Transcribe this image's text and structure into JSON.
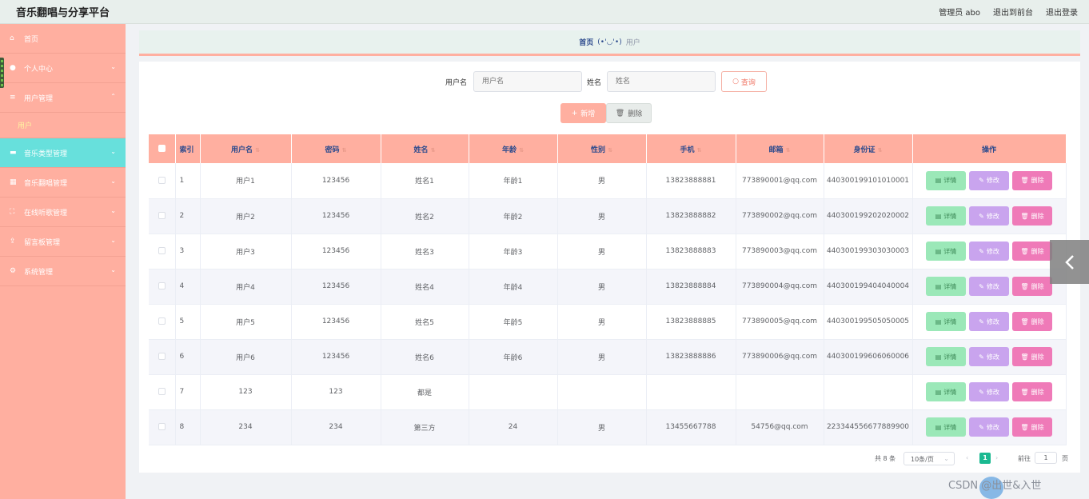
{
  "header": {
    "title": "音乐翻唱与分享平台",
    "admin": "管理员 abo",
    "back_front": "退出到前台",
    "logout": "退出登录"
  },
  "sidebar": {
    "items": [
      {
        "label": "首页",
        "icon": "home-icon"
      },
      {
        "label": "个人中心",
        "icon": "user-icon"
      },
      {
        "label": "用户管理",
        "icon": "list-icon"
      },
      {
        "label": "音乐类型管理",
        "icon": "music-type-icon"
      },
      {
        "label": "音乐翻唱管理",
        "icon": "grid-icon"
      },
      {
        "label": "在线听歌管理",
        "icon": "fullscreen-icon"
      },
      {
        "label": "留言板管理",
        "icon": "upload-icon"
      },
      {
        "label": "系统管理",
        "icon": "settings-icon"
      }
    ],
    "sub_user": "用户"
  },
  "breadcrumb": {
    "home": "首页",
    "face": "(•'◡'•)",
    "current": "用户"
  },
  "search": {
    "username_label": "用户名",
    "username_placeholder": "用户名",
    "name_label": "姓名",
    "name_placeholder": "姓名",
    "query_btn": "查询"
  },
  "actions": {
    "add": "新增",
    "delete": "删除"
  },
  "table": {
    "headers": [
      "索引",
      "用户名",
      "密码",
      "姓名",
      "年龄",
      "性别",
      "手机",
      "邮箱",
      "身份证",
      "操作"
    ],
    "rows": [
      {
        "idx": "1",
        "username": "用户1",
        "password": "123456",
        "name": "姓名1",
        "age": "年龄1",
        "gender": "男",
        "phone": "13823888881",
        "email": "773890001@qq.com",
        "idcard": "440300199101010001"
      },
      {
        "idx": "2",
        "username": "用户2",
        "password": "123456",
        "name": "姓名2",
        "age": "年龄2",
        "gender": "男",
        "phone": "13823888882",
        "email": "773890002@qq.com",
        "idcard": "440300199202020002"
      },
      {
        "idx": "3",
        "username": "用户3",
        "password": "123456",
        "name": "姓名3",
        "age": "年龄3",
        "gender": "男",
        "phone": "13823888883",
        "email": "773890003@qq.com",
        "idcard": "440300199303030003"
      },
      {
        "idx": "4",
        "username": "用户4",
        "password": "123456",
        "name": "姓名4",
        "age": "年龄4",
        "gender": "男",
        "phone": "13823888884",
        "email": "773890004@qq.com",
        "idcard": "440300199404040004"
      },
      {
        "idx": "5",
        "username": "用户5",
        "password": "123456",
        "name": "姓名5",
        "age": "年龄5",
        "gender": "男",
        "phone": "13823888885",
        "email": "773890005@qq.com",
        "idcard": "440300199505050005"
      },
      {
        "idx": "6",
        "username": "用户6",
        "password": "123456",
        "name": "姓名6",
        "age": "年龄6",
        "gender": "男",
        "phone": "13823888886",
        "email": "773890006@qq.com",
        "idcard": "440300199606060006"
      },
      {
        "idx": "7",
        "username": "123",
        "password": "123",
        "name": "都是",
        "age": "",
        "gender": "",
        "phone": "",
        "email": "",
        "idcard": ""
      },
      {
        "idx": "8",
        "username": "234",
        "password": "234",
        "name": "第三方",
        "age": "24",
        "gender": "男",
        "phone": "13455667788",
        "email": "54756@qq.com",
        "idcard": "223344556677889900"
      }
    ],
    "op_detail": "详情",
    "op_edit": "修改",
    "op_delete": "删除"
  },
  "pagination": {
    "total": "共 8 条",
    "page_size": "10条/页",
    "current_page": "1",
    "goto_label": "前往",
    "goto_value": "1",
    "page_unit": "页"
  },
  "watermark": "CSDN @出世&入世"
}
